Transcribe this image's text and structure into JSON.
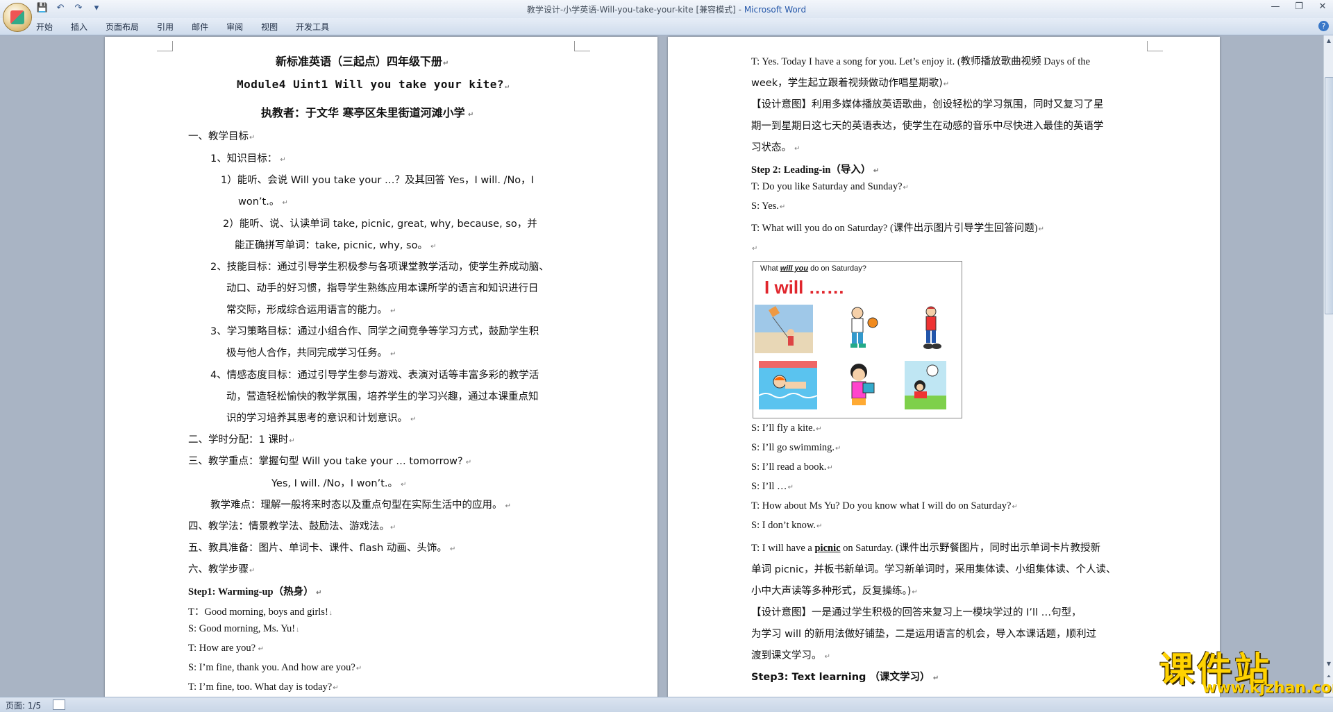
{
  "window": {
    "title": "教学设计-小学英语-Will-you-take-your-kite [兼容模式]",
    "app_sep": " - ",
    "app_name": "Microsoft Word"
  },
  "ribbon": {
    "tabs": [
      "开始",
      "插入",
      "页面布局",
      "引用",
      "邮件",
      "审阅",
      "视图",
      "开发工具"
    ]
  },
  "page1": {
    "lines": [
      "新标准英语（三起点）四年级下册",
      "Module4 Uint1 Will you take your kite?",
      "执教者：于文华   寒亭区朱里街道河滩小学",
      "一、教学目标",
      "1、知识目标：",
      "1）能听、会说 Will you take your …？及其回答 Yes，I will. /No，I",
      "won’t.。",
      "2）能听、说、认读单词 take, picnic, great, why, because, so，并",
      "能正确拼写单词：take, picnic, why, so。",
      "2、技能目标：通过引导学生积极参与各项课堂教学活动，使学生养成动脑、",
      "动口、动手的好习惯，指导学生熟练应用本课所学的语言和知识进行日",
      "常交际，形成综合运用语言的能力。",
      "3、学习策略目标：通过小组合作、同学之间竞争等学习方式，鼓励学生积",
      "极与他人合作，共同完成学习任务。",
      "4、情感态度目标：通过引导学生参与游戏、表演对话等丰富多彩的教学活",
      "动，营造轻松愉快的教学氛围，培养学生的学习兴趣，通过本课重点知",
      "识的学习培养其思考的意识和计划意识。",
      "二、学时分配：1 课时",
      "三、教学重点：掌握句型 Will you take your … tomorrow?",
      "Yes, I will. /No，I won’t.。",
      "教学难点：理解一般将来时态以及重点句型在实际生活中的应用。",
      "四、教学法：情景教学法、鼓励法、游戏法。",
      "五、教具准备：图片、单词卡、课件、flash 动画、头饰。",
      "六、教学步骤",
      "Step1: Warming-up（热身）",
      "T：Good morning, boys and girls!",
      "S: Good morning, Ms. Yu!",
      "T: How are you?",
      "S: I’m fine, thank you. And how are you?",
      "T: I’m fine, too. What day is today?"
    ]
  },
  "page2": {
    "lines": [
      "T: Yes. Today I have a song for you. Let’s enjoy it. (教师播放歌曲视频 Days of the",
      "week，学生起立跟着视频做动作唱星期歌)",
      "【设计意图】利用多媒体播放英语歌曲，创设轻松的学习氛围，同时又复习了星",
      "期一到星期日这七天的英语表达，使学生在动感的音乐中尽快进入最佳的英语学",
      "习状态。",
      "Step 2: Leading-in（导入）",
      "T: Do you like Saturday and Sunday?",
      "S: Yes.",
      "T: What will you do on Saturday? (课件出示图片引导学生回答问题)",
      "S: I’ll fly a kite.",
      "S: I’ll go swimming.",
      "S: I’ll read a book.",
      "S: I’ll …",
      "T: How about Ms Yu? Do you know what I will do on Saturday?",
      "S: I don’t know.",
      "T: I will have a ",
      "picnic",
      " on Saturday. (课件出示野餐图片，同时出示单词卡片教授新",
      "单词 picnic，并板书新单词。学习新单词时，采用集体读、小组集体读、个人读、",
      "小中大声读等多种形式，反复操练。)",
      "【设计意图】一是通过学生积极的回答来复习上一模块学过的 I’ll …句型，",
      "为学习 will 的新用法做好铺垫，二是运用语言的机会，导入本课话题，顺利过",
      "渡到课文学习。",
      "Step3: Text learning （课文学习）"
    ],
    "picture": {
      "question_pre": "What ",
      "question_em": "will you",
      "question_post": " do on Saturday?",
      "headline": "I will ……"
    }
  },
  "status": {
    "page": "页面: 1/5"
  },
  "watermark": {
    "main": "课件站",
    "url": "www.kjzhan.com"
  }
}
